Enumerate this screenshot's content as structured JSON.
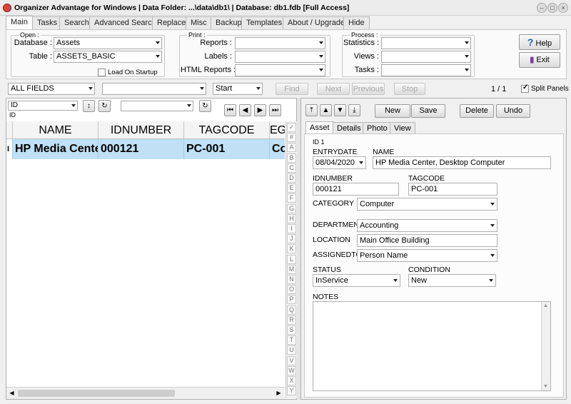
{
  "window": {
    "title": "Organizer Advantage for Windows | Data Folder: ...\\data\\db1\\ | Database: db1.fdb [Full Access]"
  },
  "tabs": [
    "Main",
    "Tasks",
    "Search",
    "Advanced Search",
    "Replace",
    "Misc",
    "Backup",
    "Templates",
    "About / Upgrade",
    "Hide"
  ],
  "open": {
    "legend": "Open :",
    "database_label": "Database :",
    "database_value": "Assets",
    "table_label": "Table :",
    "table_value": "ASSETS_BASIC",
    "load_on_startup": "Load On Startup"
  },
  "print": {
    "legend": "Print :",
    "reports_label": "Reports :",
    "labels_label": "Labels :",
    "html_reports_label": "HTML Reports :"
  },
  "process": {
    "legend": "Process :",
    "statistics_label": "Statistics :",
    "views_label": "Views :",
    "tasks_label": "Tasks :"
  },
  "buttons": {
    "help": "Help",
    "exit": "Exit"
  },
  "search": {
    "field": "ALL FIELDS",
    "mode": "Start",
    "find": "Find",
    "next": "Next",
    "previous": "Previous",
    "stop": "Stop",
    "counter": "1 / 1",
    "split_panels": "Split Panels"
  },
  "sort": {
    "field": "ID",
    "sub": "ID"
  },
  "grid": {
    "columns": [
      "NAME",
      "IDNUMBER",
      "TAGCODE",
      "EG"
    ],
    "rows": [
      {
        "indicator": "I",
        "name": "HP Media Cente",
        "idnumber": "000121",
        "tagcode": "PC-001",
        "cat": "Co"
      }
    ]
  },
  "alphabet": [
    "✓",
    "#",
    "A",
    "B",
    "C",
    "D",
    "E",
    "F",
    "G",
    "H",
    "I",
    "J",
    "K",
    "L",
    "M",
    "N",
    "O",
    "P",
    "Q",
    "R",
    "S",
    "T",
    "U",
    "V",
    "W",
    "X",
    "Y"
  ],
  "record_buttons": {
    "new": "New",
    "save": "Save",
    "delete": "Delete",
    "undo": "Undo"
  },
  "record_tabs": [
    "Asset",
    "Details",
    "Photo",
    "View"
  ],
  "record": {
    "id_label": "ID 1",
    "entrydate_label": "ENTRYDATE",
    "entrydate": "08/04/2020",
    "name_label": "NAME",
    "name": "HP Media Center, Desktop Computer",
    "idnumber_label": "IDNUMBER",
    "idnumber": "000121",
    "tagcode_label": "TAGCODE",
    "tagcode": "PC-001",
    "category_label": "CATEGORY",
    "category": "Computer",
    "department_label": "DEPARTMENT",
    "department": "Accounting",
    "location_label": "LOCATION",
    "location": "Main Office Building",
    "assignedto_label": "ASSIGNEDTO",
    "assignedto": "Person Name",
    "status_label": "STATUS",
    "status": "InService",
    "condition_label": "CONDITION",
    "condition": "New",
    "notes_label": "NOTES"
  }
}
